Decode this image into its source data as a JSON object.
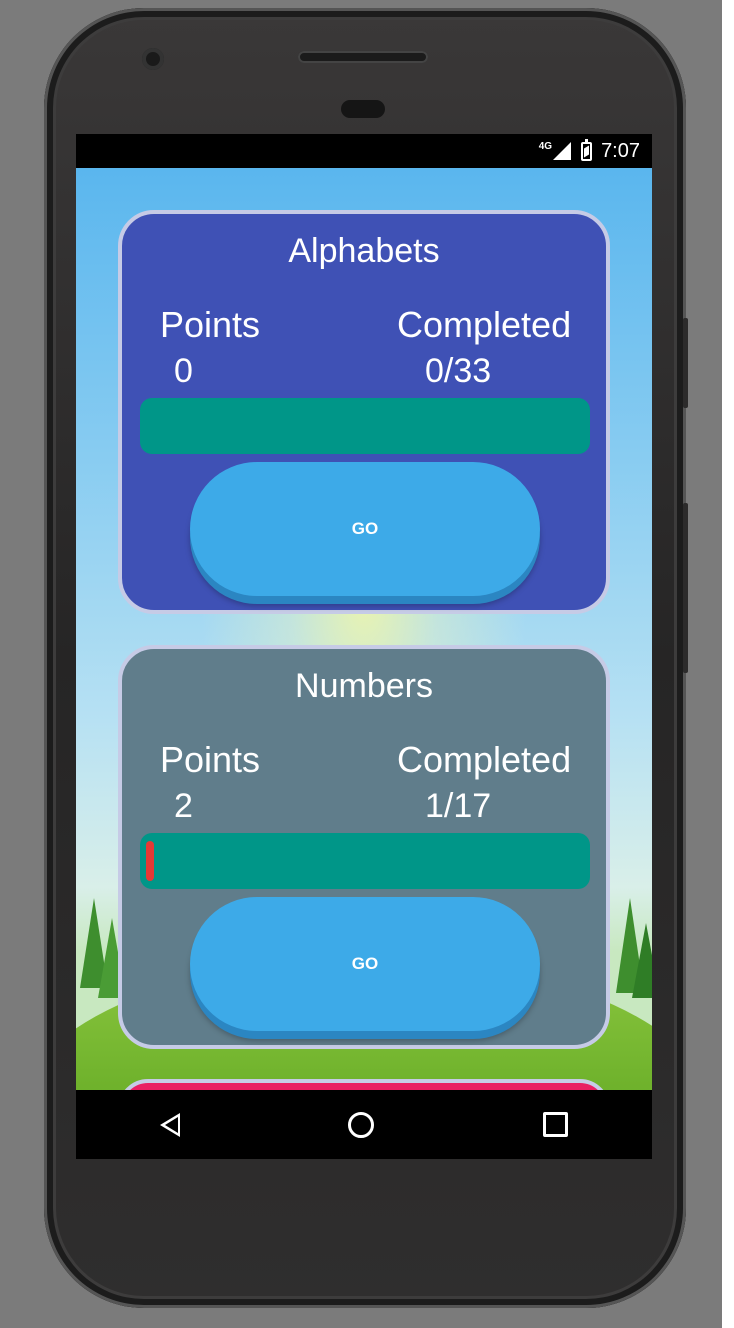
{
  "status_bar": {
    "network": "4G",
    "time": "7:07"
  },
  "categories": [
    {
      "title": "Alphabets",
      "points_label": "Points",
      "points_value": "0",
      "completed_label": "Completed",
      "completed_value": "0/33",
      "progress": 0,
      "button_label": "GO",
      "card_color": "#3f51b5"
    },
    {
      "title": "Numbers",
      "points_label": "Points",
      "points_value": "2",
      "completed_label": "Completed",
      "completed_value": "1/17",
      "progress": 0.0588,
      "button_label": "GO",
      "card_color": "#607d8b"
    }
  ],
  "colors": {
    "progress_track": "#009688",
    "progress_fill": "#e53935",
    "button": "#3daae8",
    "peek_card": "#e91e63"
  },
  "nav_bar": {
    "icons": [
      "back-icon",
      "home-icon",
      "recents-icon"
    ]
  }
}
